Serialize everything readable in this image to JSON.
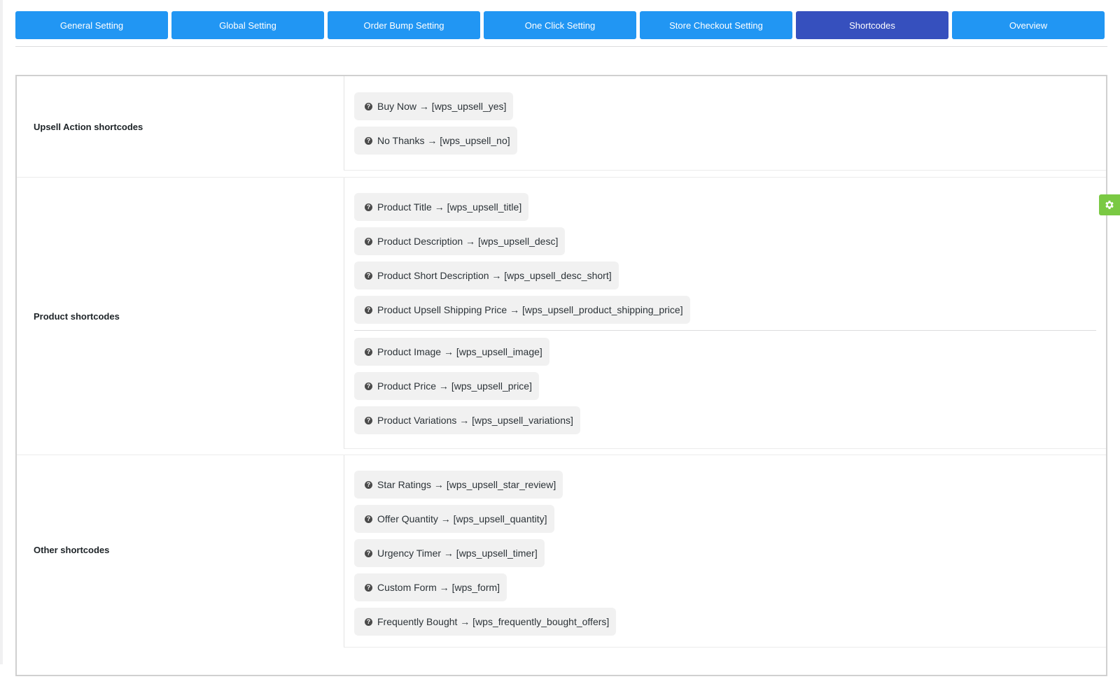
{
  "tabs": [
    {
      "label": "General Setting"
    },
    {
      "label": "Global Setting"
    },
    {
      "label": "Order Bump Setting"
    },
    {
      "label": "One Click Setting"
    },
    {
      "label": "Store Checkout Setting"
    },
    {
      "label": "Shortcodes",
      "active": true
    },
    {
      "label": "Overview"
    }
  ],
  "sections": [
    {
      "label": "Upsell Action shortcodes",
      "items": [
        "Buy Now → [wps_upsell_yes]",
        "No Thanks → [wps_upsell_no]"
      ]
    },
    {
      "label": "Product shortcodes",
      "items": [
        "Product Title → [wps_upsell_title]",
        "Product Description → [wps_upsell_desc]",
        "Product Short Description → [wps_upsell_desc_short]",
        "Product Upsell Shipping Price → [wps_upsell_product_shipping_price]",
        "Product Image → [wps_upsell_image]",
        "Product Price → [wps_upsell_price]",
        "Product Variations → [wps_upsell_variations]"
      ]
    },
    {
      "label": "Other shortcodes",
      "items": [
        "Star Ratings → [wps_upsell_star_review]",
        "Offer Quantity → [wps_upsell_quantity]",
        "Urgency Timer → [wps_upsell_timer]",
        "Custom Form → [wps_form]",
        "Frequently Bought → [wps_frequently_bought_offers]"
      ]
    }
  ],
  "colors": {
    "tab": "#2196f3",
    "tab_active": "#3650be",
    "gear": "#7ac943"
  },
  "icons": {
    "chip": "question-circle-icon",
    "floating": "gear-icon"
  }
}
